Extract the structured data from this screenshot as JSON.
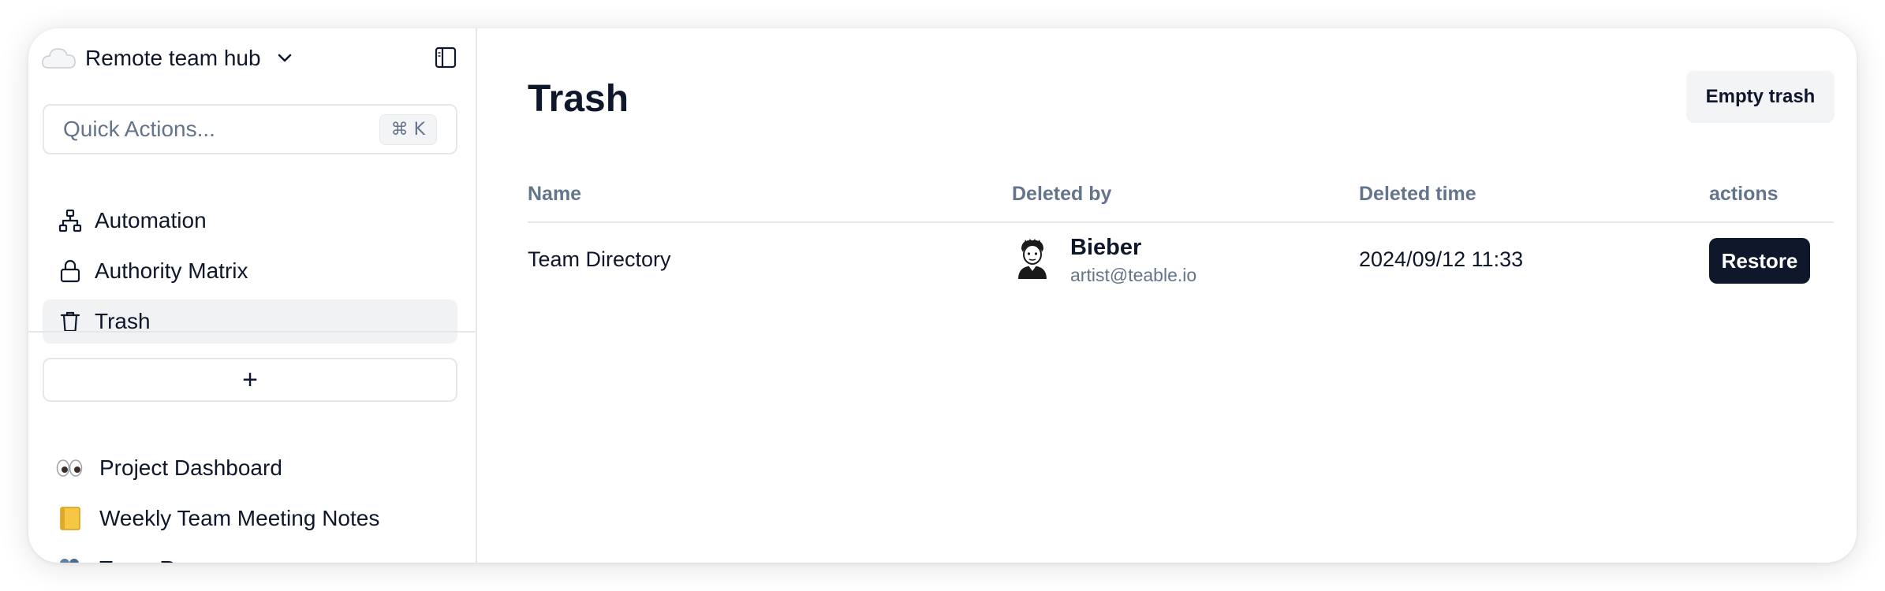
{
  "space": {
    "name": "Remote team hub",
    "icon": "cloud-icon"
  },
  "sidebar": {
    "quick_actions": {
      "placeholder": "Quick Actions...",
      "shortcut": "⌘ K"
    },
    "nav_items": [
      {
        "label": "Automation",
        "icon": "automation-icon"
      },
      {
        "label": "Authority Matrix",
        "icon": "lock-icon"
      },
      {
        "label": "Trash",
        "icon": "trash-icon",
        "active": true
      }
    ],
    "add_label": "+",
    "bases": [
      {
        "emoji": "👀",
        "label": "Project Dashboard"
      },
      {
        "emoji": "📒",
        "label": "Weekly Team Meeting Notes"
      },
      {
        "emoji": "👥",
        "label": "Team Resources"
      }
    ]
  },
  "main": {
    "title": "Trash",
    "empty_button": "Empty trash",
    "columns": [
      "Name",
      "Deleted by",
      "Deleted time",
      "actions"
    ],
    "rows": [
      {
        "name": "Team Directory",
        "deleted_by": {
          "name": "Bieber",
          "email": "artist@teable.io"
        },
        "deleted_time": "2024/09/12 11:33",
        "action": "Restore"
      }
    ]
  },
  "colors": {
    "primary": "#0f172a",
    "muted": "#64748b",
    "border": "#e5e7eb",
    "active_bg": "#f1f2f4"
  }
}
